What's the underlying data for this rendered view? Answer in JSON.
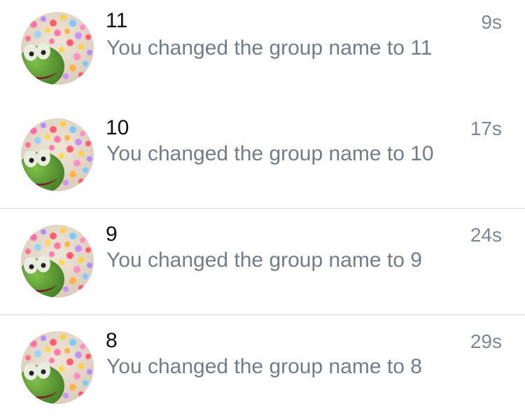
{
  "conversations": [
    {
      "title": "11",
      "preview": "You changed the group name to 11",
      "time": "9s",
      "avatar": "kermit-hearts-avatar"
    },
    {
      "title": "10",
      "preview": "You changed the group name to 10",
      "time": "17s",
      "avatar": "kermit-hearts-avatar"
    },
    {
      "title": "9",
      "preview": "You changed the group name to 9",
      "time": "24s",
      "avatar": "kermit-hearts-avatar"
    },
    {
      "title": "8",
      "preview": "You changed the group name to 8",
      "time": "29s",
      "avatar": "kermit-hearts-avatar"
    }
  ],
  "colors": {
    "title": "#111111",
    "preview": "#737c87",
    "time": "#7e8791",
    "divider": "#d9d9dc",
    "kermit_green": "#5c9e3a"
  }
}
